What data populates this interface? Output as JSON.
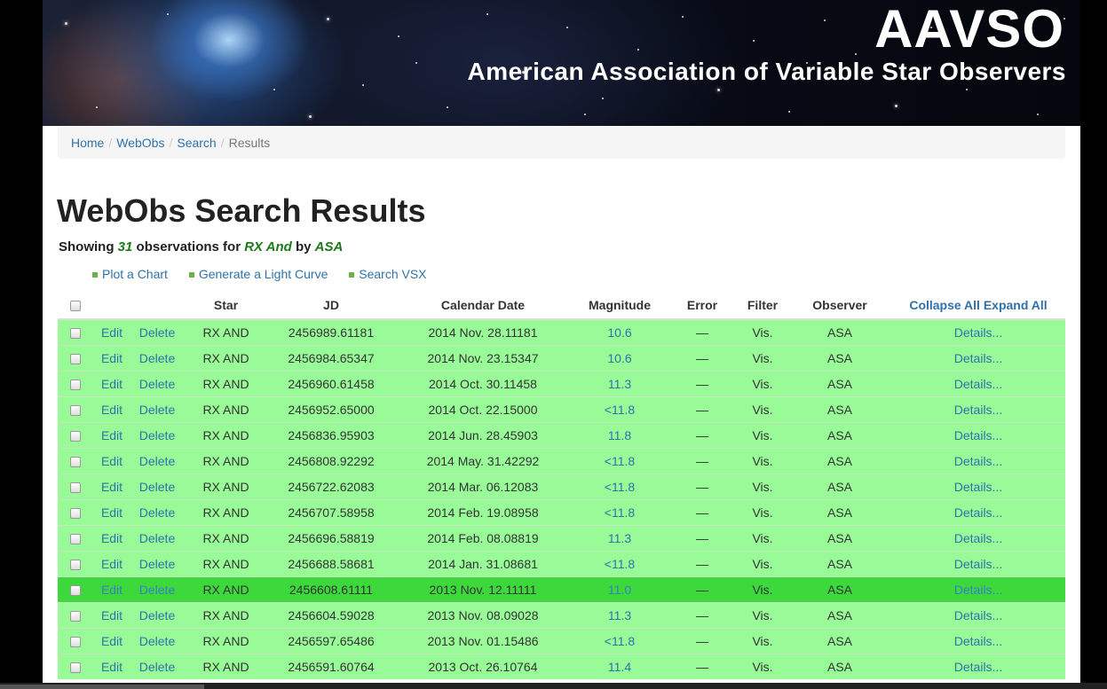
{
  "header": {
    "logo": "AAVSO",
    "tagline": "American Association of Variable Star Observers"
  },
  "breadcrumb": {
    "home": "Home",
    "webobs": "WebObs",
    "search": "Search",
    "current": "Results",
    "sep": "/"
  },
  "page_title": "WebObs Search Results",
  "summary": {
    "prefix": "Showing ",
    "count": "31",
    "mid1": " observations for ",
    "star": "RX And",
    "mid2": " by ",
    "observer": "ASA"
  },
  "actions": [
    "Plot a Chart",
    "Generate a Light Curve",
    "Search VSX"
  ],
  "table": {
    "headers": [
      "Star",
      "JD",
      "Calendar Date",
      "Magnitude",
      "Error",
      "Filter",
      "Observer"
    ],
    "collapse_label": "Collapse All",
    "expand_label": "Expand All",
    "edit_label": "Edit",
    "delete_label": "Delete",
    "details_label": "Details...",
    "rows": [
      {
        "star": "RX AND",
        "jd": "2456989.61181",
        "date": "2014 Nov. 28.11181",
        "mag": "10.6",
        "err": "—",
        "filter": "Vis.",
        "observer": "ASA"
      },
      {
        "star": "RX AND",
        "jd": "2456984.65347",
        "date": "2014 Nov. 23.15347",
        "mag": "10.6",
        "err": "—",
        "filter": "Vis.",
        "observer": "ASA"
      },
      {
        "star": "RX AND",
        "jd": "2456960.61458",
        "date": "2014 Oct. 30.11458",
        "mag": "11.3",
        "err": "—",
        "filter": "Vis.",
        "observer": "ASA"
      },
      {
        "star": "RX AND",
        "jd": "2456952.65000",
        "date": "2014 Oct. 22.15000",
        "mag": "<11.8",
        "err": "—",
        "filter": "Vis.",
        "observer": "ASA"
      },
      {
        "star": "RX AND",
        "jd": "2456836.95903",
        "date": "2014 Jun. 28.45903",
        "mag": "11.8",
        "err": "—",
        "filter": "Vis.",
        "observer": "ASA"
      },
      {
        "star": "RX AND",
        "jd": "2456808.92292",
        "date": "2014 May. 31.42292",
        "mag": "<11.8",
        "err": "—",
        "filter": "Vis.",
        "observer": "ASA"
      },
      {
        "star": "RX AND",
        "jd": "2456722.62083",
        "date": "2014 Mar. 06.12083",
        "mag": "<11.8",
        "err": "—",
        "filter": "Vis.",
        "observer": "ASA"
      },
      {
        "star": "RX AND",
        "jd": "2456707.58958",
        "date": "2014 Feb. 19.08958",
        "mag": "<11.8",
        "err": "—",
        "filter": "Vis.",
        "observer": "ASA"
      },
      {
        "star": "RX AND",
        "jd": "2456696.58819",
        "date": "2014 Feb. 08.08819",
        "mag": "11.3",
        "err": "—",
        "filter": "Vis.",
        "observer": "ASA"
      },
      {
        "star": "RX AND",
        "jd": "2456688.58681",
        "date": "2014 Jan. 31.08681",
        "mag": "<11.8",
        "err": "—",
        "filter": "Vis.",
        "observer": "ASA"
      },
      {
        "star": "RX AND",
        "jd": "2456608.61111",
        "date": "2013 Nov. 12.11111",
        "mag": "11.0",
        "err": "—",
        "filter": "Vis.",
        "observer": "ASA",
        "active": true
      },
      {
        "star": "RX AND",
        "jd": "2456604.59028",
        "date": "2013 Nov. 08.09028",
        "mag": "11.3",
        "err": "—",
        "filter": "Vis.",
        "observer": "ASA"
      },
      {
        "star": "RX AND",
        "jd": "2456597.65486",
        "date": "2013 Nov. 01.15486",
        "mag": "<11.8",
        "err": "—",
        "filter": "Vis.",
        "observer": "ASA"
      },
      {
        "star": "RX AND",
        "jd": "2456591.60764",
        "date": "2013 Oct. 26.10764",
        "mag": "11.4",
        "err": "—",
        "filter": "Vis.",
        "observer": "ASA"
      }
    ]
  },
  "colors": {
    "row_bg": "#98fb98",
    "row_active_bg": "#3cd83c",
    "link": "#3071a9",
    "highlight_text": "#1c7a1c"
  }
}
